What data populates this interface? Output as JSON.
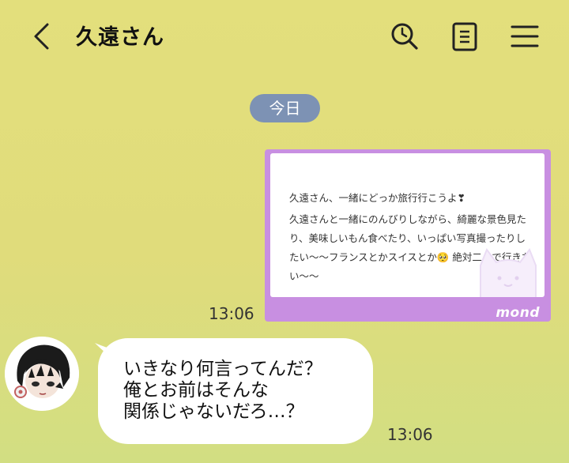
{
  "header": {
    "title": "久遠さん",
    "icons": [
      "chevron-left-icon",
      "search-icon",
      "notes-icon",
      "menu-icon"
    ]
  },
  "date_divider": "今日",
  "messages": [
    {
      "kind": "image",
      "line1": "久遠さん、一緒にどっか旅行行こうよ❣",
      "body": "久遠さんと一緒にのんびりしながら、綺麗な景色見たり、美味しいもん食べたり、いっぱい写真撮ったりしたい〜〜フランスとかスイスとか🥺 絶対二人で行きたい〜〜",
      "brand": "mond",
      "time": "13:06"
    },
    {
      "kind": "text",
      "lines": [
        "いきなり何言ってんだ？",
        "俺とお前はそんな",
        "関係じゃないだろ…？"
      ],
      "time": "13:06"
    }
  ],
  "colors": {
    "background": "#e3df7c",
    "date_pill": "#7d92b4",
    "image_frame": "#c88fe1",
    "bubble": "#ffffff"
  }
}
